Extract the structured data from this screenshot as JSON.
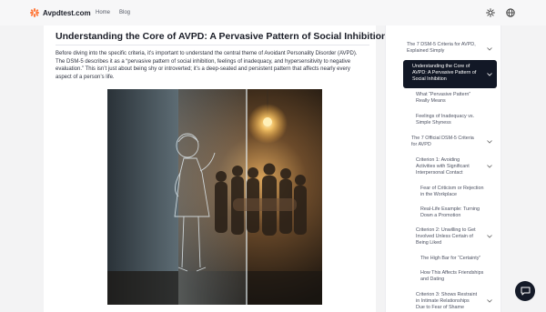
{
  "site": {
    "logo_text": "Avpdtest.com"
  },
  "nav": {
    "home_label": "Home",
    "blog_label": "Blog"
  },
  "header_icons": {
    "theme": "sun-icon",
    "language": "globe-icon"
  },
  "article": {
    "title": "Understanding the Core of AVPD: A Pervasive Pattern of Social Inhibition",
    "paragraph_lines": [
      "Before diving into the specific criteria, it’s important to understand the central theme of Avoidant Personality Disorder (AVPD).",
      "The DSM-5 describes it as a “pervasive pattern of social inhibition, feelings of inadequacy, and hypersensitivity to negative",
      "evaluation.” This isn’t just about being shy or introverted; it’s a deep-seated and persistent pattern that affects nearly every",
      "aspect of a person’s life."
    ]
  },
  "toc": {
    "items": [
      {
        "lines": [
          "The 7 DSM-5 Criteria for AVPD,",
          "Explained Simply"
        ],
        "chevron": true,
        "active": false
      },
      {
        "lines": [
          "Understanding the Core of",
          "AVPD: A Pervasive Pattern of",
          "Social Inhibition"
        ],
        "chevron": true,
        "active": true
      },
      {
        "lines": [
          "What “Pervasive Pattern”",
          "Really Means"
        ],
        "chevron": false,
        "active": false
      },
      {
        "lines": [
          "Feelings of Inadequacy vs.",
          "Simple Shyness"
        ],
        "chevron": false,
        "active": false
      },
      {
        "lines": [
          "The 7 Official DSM-5 Criteria",
          "for AVPD"
        ],
        "chevron": true,
        "active": false
      },
      {
        "lines": [
          "Criterion 1: Avoiding",
          "Activities with Significant",
          "Interpersonal Contact"
        ],
        "chevron": true,
        "active": false
      },
      {
        "lines": [
          "Fear of Criticism or Rejection",
          "in the Workplace"
        ],
        "chevron": false,
        "active": false
      },
      {
        "lines": [
          "Real-Life Example: Turning",
          "Down a Promotion"
        ],
        "chevron": false,
        "active": false
      },
      {
        "lines": [
          "Criterion 2: Unwilling to Get",
          "Involved Unless Certain of",
          "Being Liked"
        ],
        "chevron": true,
        "active": false
      },
      {
        "lines": [
          "The High Bar for “Certainty”"
        ],
        "chevron": false,
        "active": false
      },
      {
        "lines": [
          "How This Affects Friendships",
          "and Dating"
        ],
        "chevron": false,
        "active": false
      },
      {
        "lines": [
          "Criterion 3: Shows Restraint",
          "in Intimate Relationships",
          "Due to Fear of Shame"
        ],
        "chevron": true,
        "active": false
      }
    ]
  },
  "colors": {
    "accent": "#ff7a3d",
    "active_bg": "#121826",
    "chat_bg": "#141a28"
  },
  "chat": {
    "icon": "chat-bubble-icon"
  }
}
